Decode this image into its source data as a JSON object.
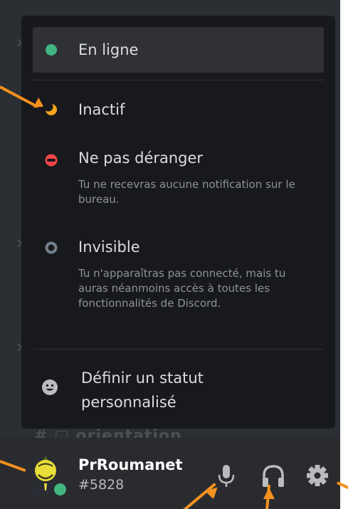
{
  "status_menu": {
    "items": [
      {
        "id": "online",
        "label": "En ligne",
        "dot_color": "#43b581",
        "icon": "online-dot-icon",
        "selected": true
      },
      {
        "id": "idle",
        "label": "Inactif",
        "dot_color": "#faa61a",
        "icon": "moon-icon"
      },
      {
        "id": "dnd",
        "label": "Ne pas déranger",
        "description": "Tu ne recevras aucune notification sur le bureau.",
        "dot_color": "#f04747",
        "icon": "do-not-disturb-icon"
      },
      {
        "id": "invisible",
        "label": "Invisible",
        "description": "Tu n'apparaîtras pas connecté, mais tu auras néanmoins accès à toutes les fonctionnalités de Discord.",
        "dot_color": "#747f8d",
        "icon": "invisible-ring-icon"
      }
    ],
    "custom_status": {
      "label": "Définir un statut personnalisé",
      "icon": "smiley-icon"
    }
  },
  "user_panel": {
    "username": "PrRoumanet",
    "tag": "#5828",
    "status_color": "#43b581",
    "controls": [
      {
        "id": "mute",
        "icon": "microphone-icon"
      },
      {
        "id": "deafen",
        "icon": "headphones-icon"
      },
      {
        "id": "settings",
        "icon": "gear-icon"
      }
    ]
  },
  "colors": {
    "menu_bg": "#18191c",
    "app_bg": "#2b2e33",
    "panel_bg": "#292b2f",
    "annotation": "#f5911f"
  }
}
